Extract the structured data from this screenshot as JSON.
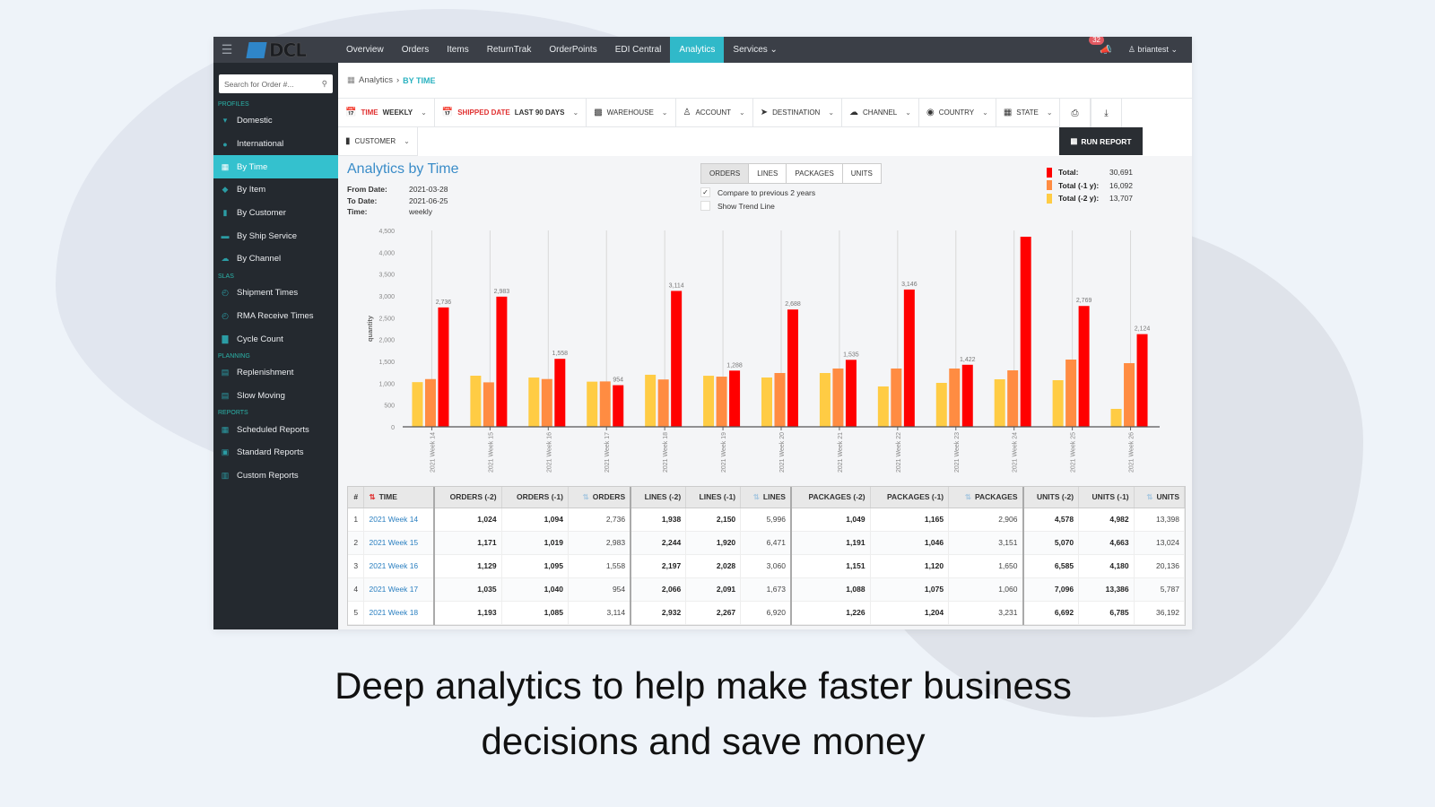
{
  "app": {
    "logo_text": "DCL",
    "nav": [
      "Overview",
      "Orders",
      "Items",
      "ReturnTrak",
      "OrderPoints",
      "EDI Central",
      "Analytics",
      "Services"
    ],
    "nav_active": "Analytics",
    "notification_count": "32",
    "user": "briantest"
  },
  "sidebar": {
    "search_placeholder": "Search for Order #...",
    "sections": [
      {
        "title": "PROFILES",
        "items": [
          {
            "label": "Domestic",
            "icon": "map-marker-icon"
          },
          {
            "label": "International",
            "icon": "globe-icon"
          },
          {
            "label": "By Time",
            "icon": "calendar-icon",
            "active": true
          },
          {
            "label": "By Item",
            "icon": "tag-icon"
          },
          {
            "label": "By Customer",
            "icon": "building-icon"
          },
          {
            "label": "By Ship Service",
            "icon": "truck-icon"
          },
          {
            "label": "By Channel",
            "icon": "cloud-icon"
          }
        ]
      },
      {
        "title": "SLAs",
        "items": [
          {
            "label": "Shipment Times",
            "icon": "clock-icon"
          },
          {
            "label": "RMA Receive Times",
            "icon": "clock-icon"
          },
          {
            "label": "Cycle Count",
            "icon": "bar-chart-icon"
          }
        ]
      },
      {
        "title": "PLANNING",
        "items": [
          {
            "label": "Replenishment",
            "icon": "calendar-grid-icon"
          },
          {
            "label": "Slow Moving",
            "icon": "calendar-grid-icon"
          }
        ]
      },
      {
        "title": "REPORTS",
        "items": [
          {
            "label": "Scheduled Reports",
            "icon": "calendar-icon"
          },
          {
            "label": "Standard Reports",
            "icon": "grid-icon"
          },
          {
            "label": "Custom Reports",
            "icon": "table-icon"
          }
        ]
      }
    ]
  },
  "breadcrumb": {
    "root": "Analytics",
    "current": "BY TIME"
  },
  "filters": {
    "time": {
      "label": "TIME",
      "value": "WEEKLY"
    },
    "shipped_date": {
      "label": "SHIPPED DATE",
      "value": "LAST 90 DAYS"
    },
    "others": [
      "WAREHOUSE",
      "ACCOUNT",
      "DESTINATION",
      "CHANNEL",
      "COUNTRY",
      "STATE"
    ],
    "customer": "CUSTOMER",
    "run_report": "RUN REPORT"
  },
  "report": {
    "title": "Analytics by Time",
    "from_label": "From Date:",
    "from": "2021-03-28",
    "to_label": "To Date:",
    "to": "2021-06-25",
    "time_label": "Time:",
    "time": "weekly",
    "metric_tabs": [
      "ORDERS",
      "LINES",
      "PACKAGES",
      "UNITS"
    ],
    "metric_active": "ORDERS",
    "compare_label": "Compare to previous 2 years",
    "compare_checked": true,
    "trend_label": "Show Trend Line",
    "trend_checked": false,
    "legend": [
      {
        "label": "Total:",
        "value": "30,691",
        "color": "#ff0000"
      },
      {
        "label": "Total (-1 y):",
        "value": "16,092",
        "color": "#ff8c42"
      },
      {
        "label": "Total (-2 y):",
        "value": "13,707",
        "color": "#ffcc44"
      }
    ]
  },
  "chart_data": {
    "type": "bar",
    "ylabel": "quantity",
    "xlabel": "",
    "ylim": [
      0,
      4500
    ],
    "yticks": [
      0,
      500,
      1000,
      1500,
      2000,
      2500,
      3000,
      3500,
      4000,
      4500
    ],
    "grid": "vertical",
    "categories": [
      "2021 Week 14",
      "2021 Week 15",
      "2021 Week 16",
      "2021 Week 17",
      "2021 Week 18",
      "2021 Week 19",
      "2021 Week 20",
      "2021 Week 21",
      "2021 Week 22",
      "2021 Week 23",
      "2021 Week 24",
      "2021 Week 25",
      "2021 Week 26"
    ],
    "series": [
      {
        "name": "Total (-2 y)",
        "color": "#ffcc44",
        "values": [
          1024,
          1171,
          1129,
          1035,
          1193,
          1170,
          1130,
          1233,
          925,
          1007,
          1089,
          1068,
          411
        ]
      },
      {
        "name": "Total (-1 y)",
        "color": "#ff8c42",
        "values": [
          1094,
          1019,
          1095,
          1040,
          1085,
          1150,
          1233,
          1336,
          1336,
          1336,
          1294,
          1541,
          1459
        ]
      },
      {
        "name": "Total",
        "color": "#ff0000",
        "values": [
          2736,
          2983,
          1558,
          954,
          3114,
          1288,
          2688,
          1535,
          3146,
          1422,
          4356,
          2769,
          2124
        ],
        "labels": [
          "2,736",
          "2,983",
          "1,558",
          "954",
          "3,114",
          "1,288",
          "2,688",
          "1,535",
          "3,146",
          "1,422",
          "",
          "2,769",
          "2,124"
        ]
      }
    ]
  },
  "table": {
    "headers": [
      "#",
      "TIME",
      "ORDERS (-2)",
      "ORDERS (-1)",
      "ORDERS",
      "LINES (-2)",
      "LINES (-1)",
      "LINES",
      "PACKAGES (-2)",
      "PACKAGES (-1)",
      "PACKAGES",
      "UNITS (-2)",
      "UNITS (-1)",
      "UNITS"
    ],
    "rows": [
      [
        "1",
        "2021 Week 14",
        "1,024",
        "1,094",
        "2,736",
        "1,938",
        "2,150",
        "5,996",
        "1,049",
        "1,165",
        "2,906",
        "4,578",
        "4,982",
        "13,398"
      ],
      [
        "2",
        "2021 Week 15",
        "1,171",
        "1,019",
        "2,983",
        "2,244",
        "1,920",
        "6,471",
        "1,191",
        "1,046",
        "3,151",
        "5,070",
        "4,663",
        "13,024"
      ],
      [
        "3",
        "2021 Week 16",
        "1,129",
        "1,095",
        "1,558",
        "2,197",
        "2,028",
        "3,060",
        "1,151",
        "1,120",
        "1,650",
        "6,585",
        "4,180",
        "20,136"
      ],
      [
        "4",
        "2021 Week 17",
        "1,035",
        "1,040",
        "954",
        "2,066",
        "2,091",
        "1,673",
        "1,088",
        "1,075",
        "1,060",
        "7,096",
        "13,386",
        "5,787"
      ],
      [
        "5",
        "2021 Week 18",
        "1,193",
        "1,085",
        "3,114",
        "2,932",
        "2,267",
        "6,920",
        "1,226",
        "1,204",
        "3,231",
        "6,692",
        "6,785",
        "36,192"
      ]
    ]
  },
  "caption": {
    "line1": "Deep analytics to help make faster business",
    "line2": "decisions and save money"
  }
}
